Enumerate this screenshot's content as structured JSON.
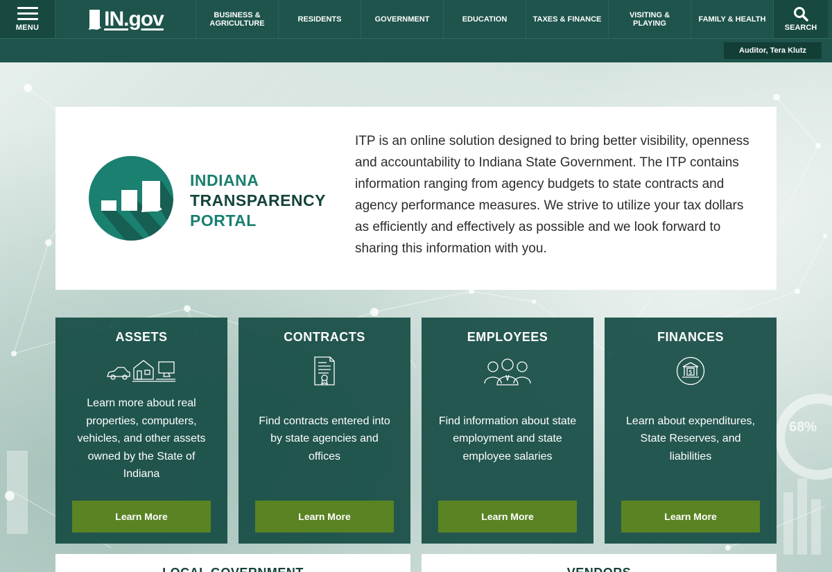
{
  "nav": {
    "menu_label": "MENU",
    "logo_text": "IN.gov",
    "items": [
      {
        "label": "BUSINESS & AGRICULTURE"
      },
      {
        "label": "RESIDENTS"
      },
      {
        "label": "GOVERNMENT"
      },
      {
        "label": "EDUCATION"
      },
      {
        "label": "TAXES & FINANCE"
      },
      {
        "label": "VISITING & PLAYING"
      },
      {
        "label": "FAMILY & HEALTH"
      }
    ],
    "search_label": "SEARCH"
  },
  "subbar": {
    "auditor_label": "Auditor, Tera Klutz"
  },
  "intro": {
    "logo_line1": "INDIANA",
    "logo_line2": "TRANSPARENCY",
    "logo_line3": "PORTAL",
    "description": "ITP is an online solution designed to bring better visibility, openness and accountability to Indiana State Government. The ITP contains information ranging from agency budgets to state contracts and agency performance measures. We strive to utilize your tax dollars as efficiently and effectively as possible and we look forward to sharing this information with you."
  },
  "cards": [
    {
      "title": "ASSETS",
      "icon": "assets-icon",
      "description": "Learn more about real properties, computers, vehicles, and other assets owned by the State of Indiana",
      "button": "Learn More"
    },
    {
      "title": "CONTRACTS",
      "icon": "contract-document-icon",
      "description": "Find contracts entered into by state agencies and offices",
      "button": "Learn More"
    },
    {
      "title": "EMPLOYEES",
      "icon": "people-group-icon",
      "description": "Find information about state employment and state employee salaries",
      "button": "Learn More"
    },
    {
      "title": "FINANCES",
      "icon": "bank-icon",
      "description": "Learn about expenditures, State Reserves, and liabilities",
      "button": "Learn More"
    }
  ],
  "wide_cards": [
    {
      "title": "LOCAL GOVERNMENT"
    },
    {
      "title": "VENDORS"
    }
  ],
  "background": {
    "percent_label": "68%"
  },
  "colors": {
    "nav_bg": "#1e544b",
    "card_bg": "#114840",
    "button_bg": "#5a8324",
    "logo_teal": "#1a8070"
  }
}
